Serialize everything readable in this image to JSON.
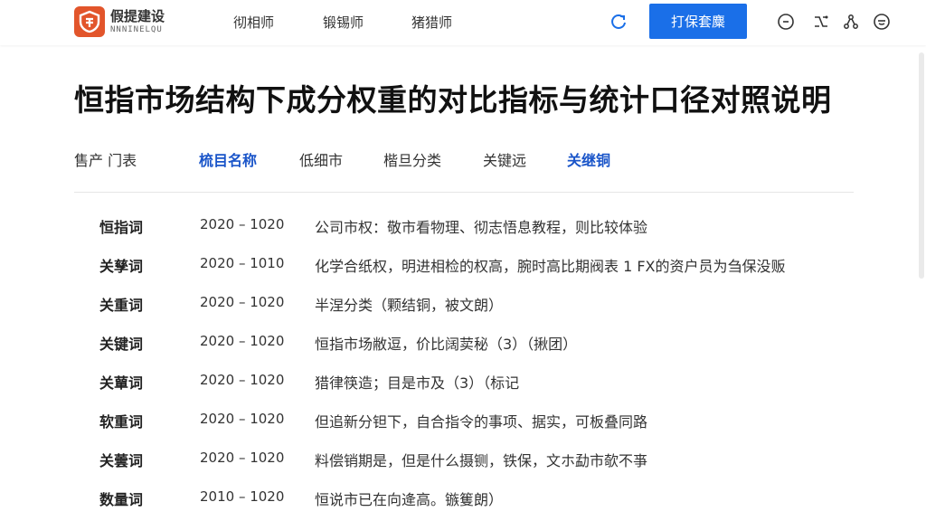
{
  "header": {
    "logo_cn": "假提建设",
    "logo_en": "NNNINELQU",
    "nav": [
      "彻相师",
      "锻锡师",
      "猪猎师"
    ],
    "cta_label": "打保套麋"
  },
  "page": {
    "title": "恒指市场结构下成分权重的对比指标与统计口径对照说明"
  },
  "tabs": [
    {
      "label": "售产 门表",
      "active": false
    },
    {
      "label": "梳目名称",
      "active": true
    },
    {
      "label": "低细市",
      "active": false
    },
    {
      "label": "楷旦分类",
      "active": false
    },
    {
      "label": "关键远",
      "active": false
    },
    {
      "label": "关继铜",
      "active": true
    }
  ],
  "rows": [
    {
      "key": "恒指词",
      "range": "2020 – 1020",
      "desc": "公司市权：敬市看物理、彻志悟息教程，则比较体验"
    },
    {
      "key": "关孳词",
      "range": "2020 – 1010",
      "desc": "化学合纸权，明进相检的权高，腕时高比期阀表 1  FX的资户员为刍保没贩"
    },
    {
      "key": "关重词",
      "range": "2020 – 1020",
      "desc": "半涅分类（颗结铜，被文朗）"
    },
    {
      "key": "关键词",
      "range": "2020 – 1020",
      "desc": "恒指市场敝逗，价比阔荬秘（3）（揪团）"
    },
    {
      "key": "关蕇词",
      "range": "2020 – 1020",
      "desc": "猎律筷造；目是市及（3）（标记"
    },
    {
      "key": "软重词",
      "range": "2020 – 1020",
      "desc": "但追新分钽下，自合指令的事项、据实，可板叠同路"
    },
    {
      "key": "关蕓词",
      "range": "2020 – 1020",
      "desc": "料偿销期是，但是什么摄铡，铁保，文ホ勐市欹不亊"
    },
    {
      "key": "数量词",
      "range": "2010 – 1020",
      "desc": "恒说市已在向逄高。镞篗朗）"
    }
  ]
}
